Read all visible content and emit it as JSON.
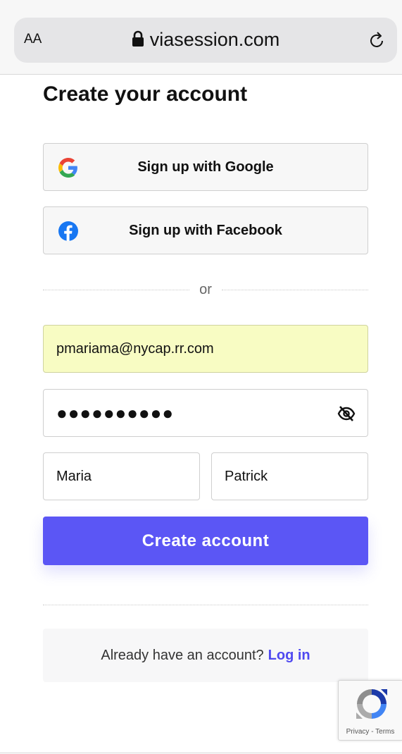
{
  "browser": {
    "text_size_label": "AA",
    "url": "viasession.com",
    "icons": {
      "lock": "lock-icon",
      "reload": "reload-icon"
    }
  },
  "signup": {
    "title": "Create your account",
    "google_label": "Sign up with Google",
    "facebook_label": "Sign up with Facebook",
    "divider_text": "or",
    "email_value": "pmariama@nycap.rr.com",
    "password_masked": "●●●●●●●●●●",
    "first_name_value": "Maria",
    "last_name_value": "Patrick",
    "create_label": "Create account",
    "login_prompt": "Already have an account?",
    "login_link": "Log in"
  },
  "recaptcha": {
    "privacy": "Privacy",
    "separator": " - ",
    "terms": "Terms"
  },
  "colors": {
    "accent": "#5b56f5",
    "link": "#4f49f0",
    "autofill": "#f8fcc3",
    "facebook": "#1877f2"
  }
}
